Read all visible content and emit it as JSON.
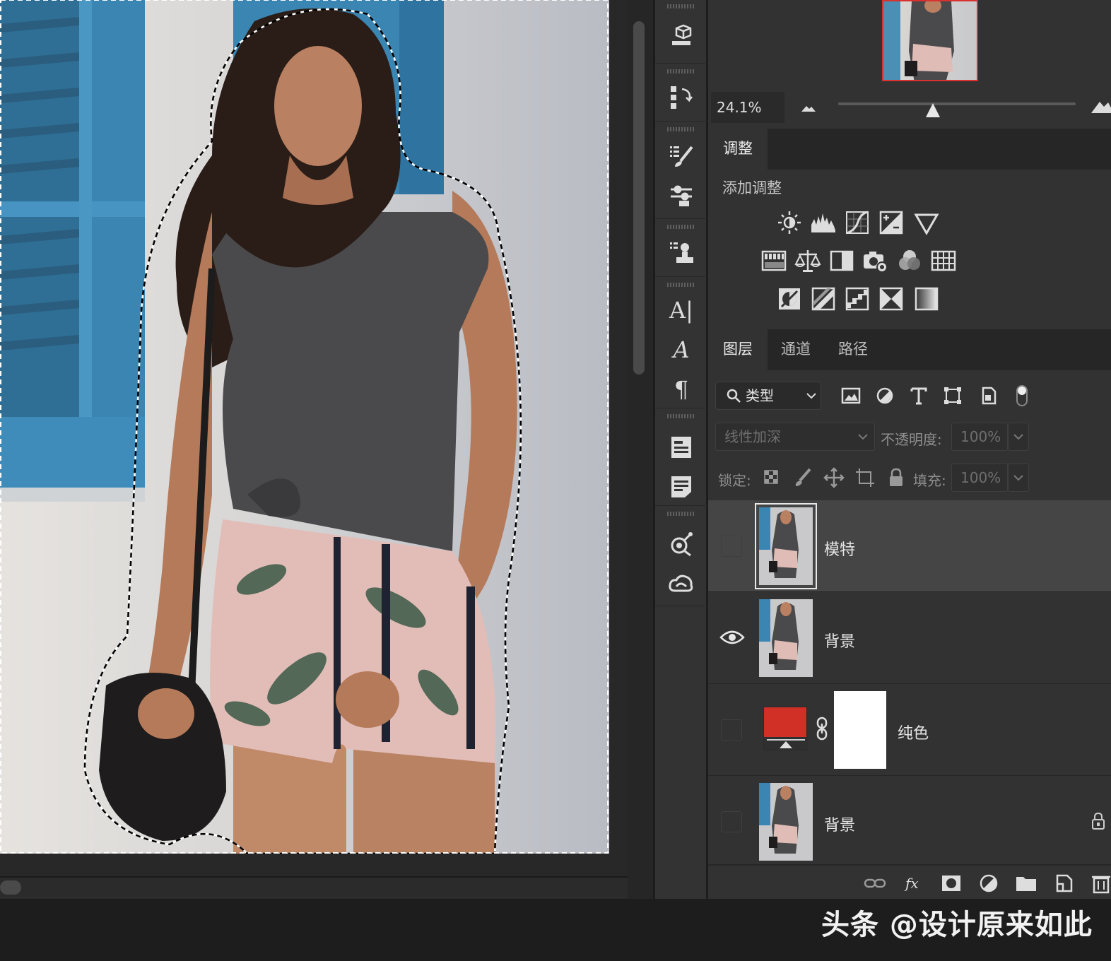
{
  "navigator": {
    "zoom_value": "24.1%",
    "zoom_level_fraction": 0.4
  },
  "adjustments": {
    "tab_label": "调整",
    "title": "添加调整",
    "row1": [
      "brightness-contrast-icon",
      "levels-icon",
      "curves-icon",
      "exposure-icon",
      "vibrance-icon"
    ],
    "row2": [
      "hue-saturation-icon",
      "color-balance-icon",
      "black-white-icon",
      "photo-filter-icon",
      "channel-mixer-icon",
      "color-lookup-icon"
    ],
    "row3": [
      "invert-icon",
      "posterize-icon",
      "threshold-icon",
      "selective-color-icon",
      "gradient-map-icon"
    ]
  },
  "layers_panel": {
    "tabs": [
      "图层",
      "通道",
      "路径"
    ],
    "active_tab": 0,
    "filter_label": "类型",
    "blend_mode": "线性加深",
    "opacity_label": "不透明度:",
    "opacity_value": "100%",
    "lock_label": "锁定:",
    "fill_label": "填充:",
    "fill_value": "100%",
    "layers": [
      {
        "name": "模特",
        "visible": false,
        "selected": true,
        "type": "pixel"
      },
      {
        "name": "背景",
        "visible": true,
        "selected": false,
        "type": "pixel"
      },
      {
        "name": "纯色",
        "visible": false,
        "selected": false,
        "type": "solid-color",
        "fill_color": "#d03025",
        "mask_color": "#ffffff"
      },
      {
        "name": "背景",
        "visible": false,
        "selected": false,
        "type": "pixel",
        "locked": true
      }
    ]
  },
  "colors": {
    "panel_bg": "#323232",
    "selected_layer": "#454545",
    "solid_fill": "#d03025",
    "shutter_blue": "#3a85b2"
  },
  "watermark": "头条 @设计原来如此"
}
